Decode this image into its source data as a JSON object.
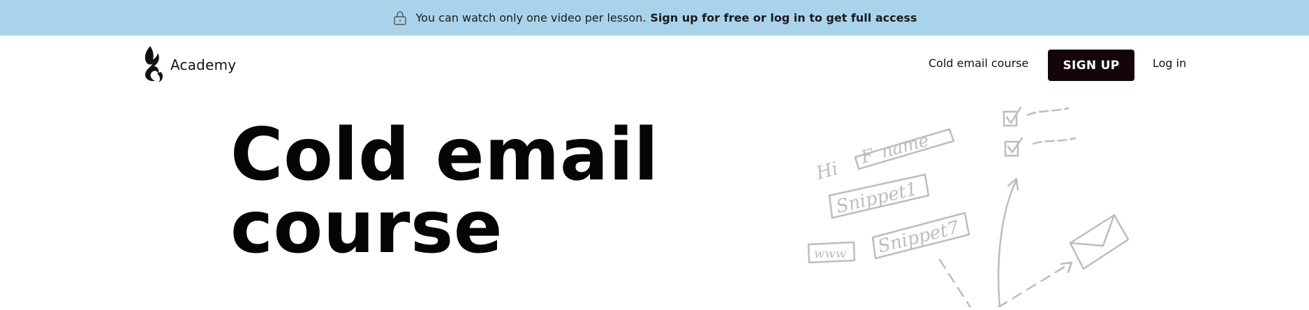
{
  "banner": {
    "lock_icon": "lock-icon",
    "message": "You can watch only one video per lesson.",
    "cta": "Sign up for free or log in to get full access",
    "background": "#a9d3ea"
  },
  "header": {
    "logo_icon": "flame-logo-icon",
    "logo_text": "Academy",
    "nav": {
      "course_link": "Cold email course",
      "signup_button": "SIGN UP",
      "login_link": "Log in"
    },
    "signup_button_color": "#150508"
  },
  "hero": {
    "title_line1": "Cold email",
    "title_line2": "course"
  },
  "illustration": {
    "greeting": "Hi",
    "fname_tag": "F_name",
    "snippet1_tag": "Snippet1",
    "snippet7_tag": "Snippet7",
    "www_tag": "www",
    "icons": [
      "checkbox-icon",
      "checkbox-icon",
      "envelope-icon",
      "arrow-icon"
    ],
    "stroke_color": "#bdbdbd"
  }
}
